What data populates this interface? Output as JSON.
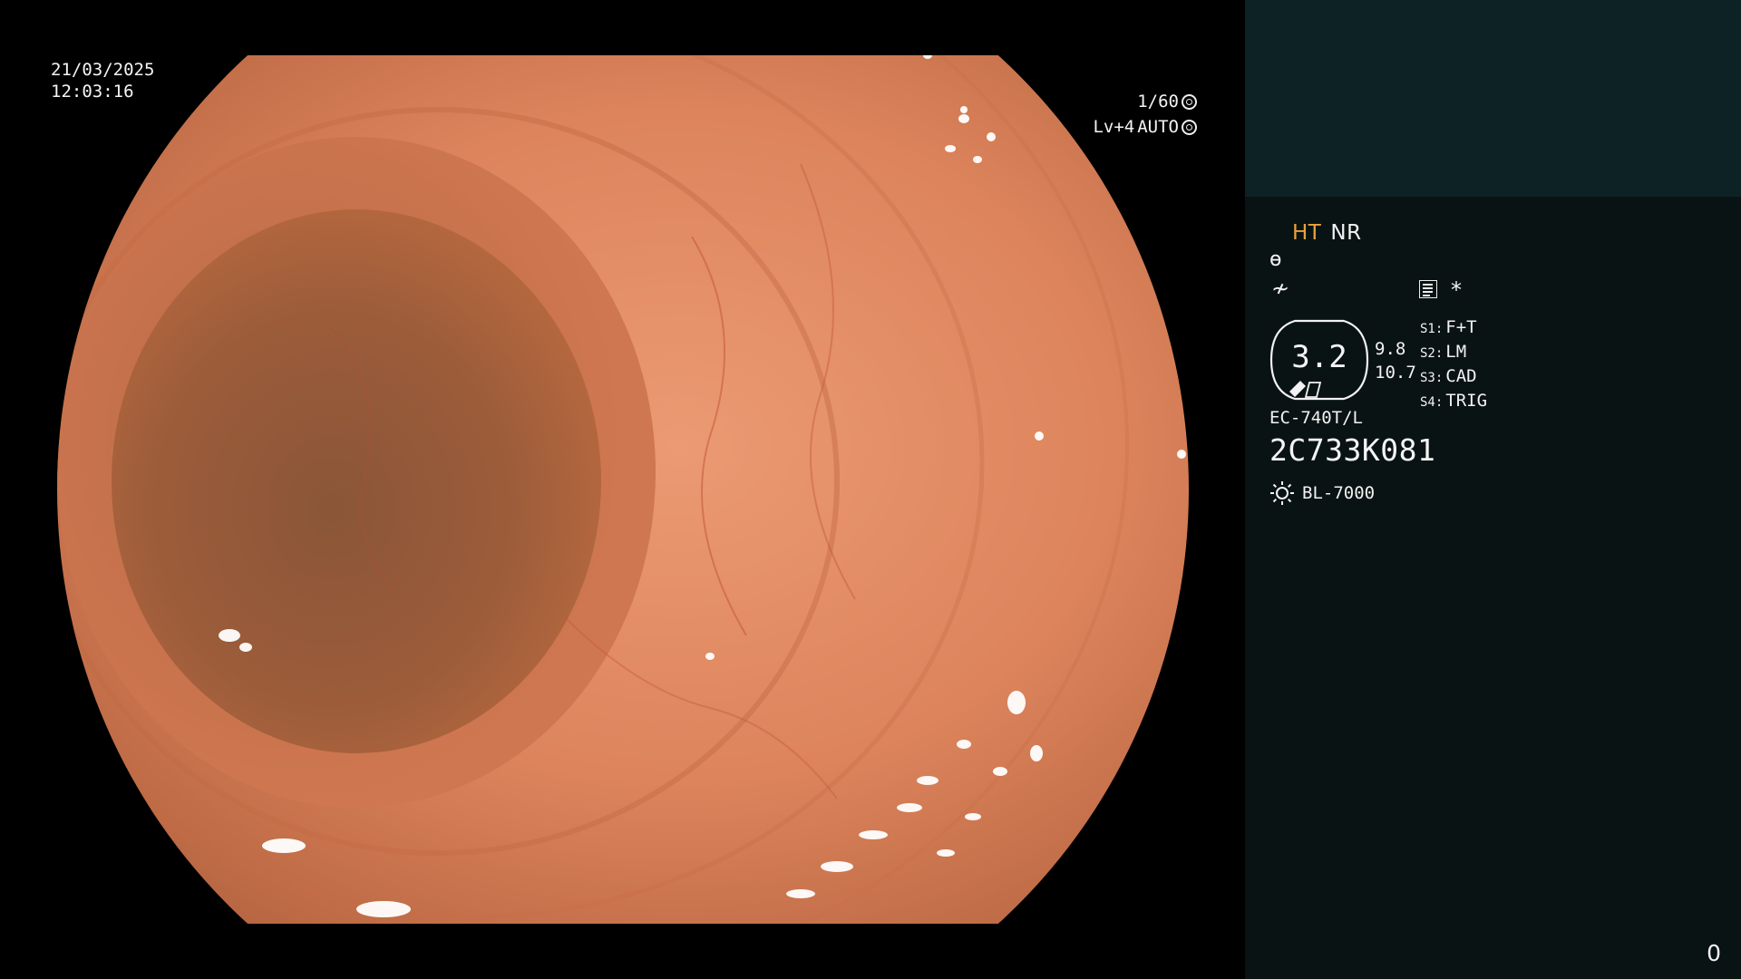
{
  "osd": {
    "date": "21/03/2025",
    "time": "12:03:16",
    "shutter": "1/60",
    "shutter_icon": "aperture-icon",
    "level": "Lv+4",
    "mode": "AUTO",
    "mode_icon": "iris-icon"
  },
  "panel": {
    "mode_ht": "HT",
    "mode_nr": "NR",
    "symbol_1": "ɵ",
    "symbol_2": "≁",
    "star": "*",
    "zoom_value": "3.2",
    "value_top": "9.8",
    "value_bottom": "10.7",
    "switches": [
      {
        "key": "S1:",
        "label": "F+T"
      },
      {
        "key": "S2:",
        "label": "LM"
      },
      {
        "key": "S3:",
        "label": "CAD"
      },
      {
        "key": "S4:",
        "label": "TRIG"
      }
    ],
    "scope_model": "EC-740T/L",
    "scope_serial": "2C733K081",
    "light_source": "BL-7000",
    "light_icon": "sun-icon",
    "counter": "0"
  },
  "colors": {
    "background": "#000000",
    "panel": "#0a1313",
    "thumb_area": "#0d2224",
    "ht_accent": "#e8a33c",
    "tissue": "#d9835e"
  }
}
